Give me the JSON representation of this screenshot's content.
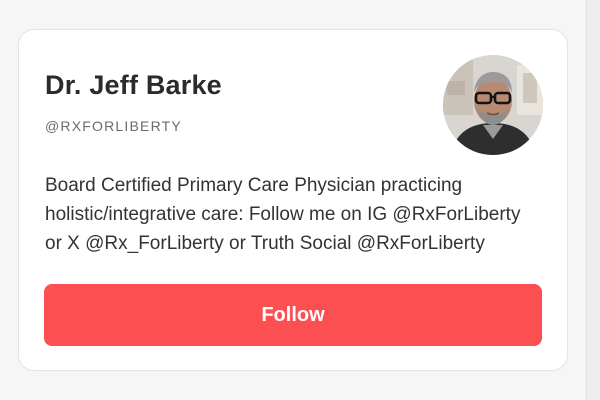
{
  "profile": {
    "name": "Dr. Jeff Barke",
    "handle": "@RXFORLIBERTY",
    "bio": "Board Certified Primary Care Physician practicing holistic/integrative care: Follow me on IG @RxForLiberty or X @Rx_ForLiberty or Truth Social @RxForLiberty",
    "avatar_icon": "profile-photo"
  },
  "actions": {
    "follow_label": "Follow"
  },
  "colors": {
    "accent": "#fb4f52",
    "card_bg": "#ffffff",
    "page_bg": "#f6f6f6"
  }
}
